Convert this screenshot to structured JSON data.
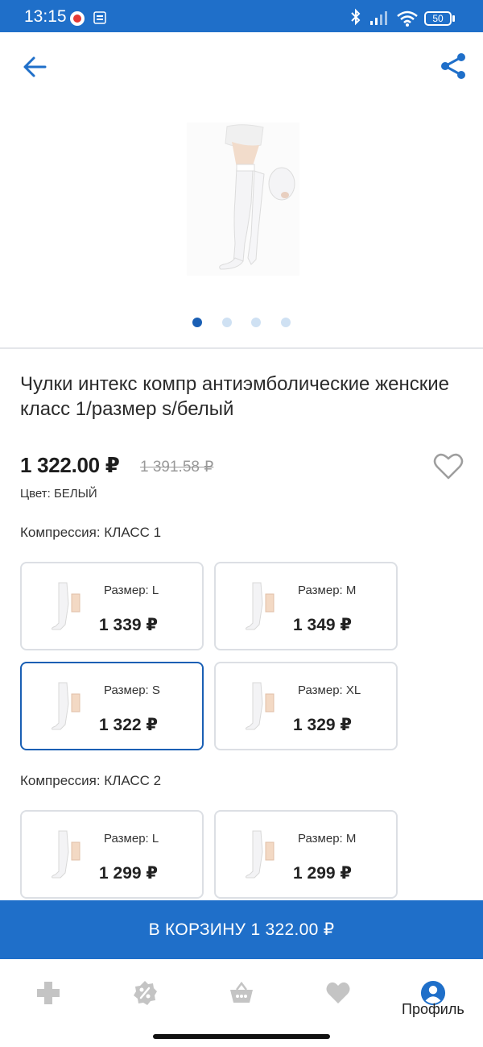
{
  "status_bar": {
    "time": "13:15",
    "battery": "50"
  },
  "header": {
    "back_icon": "arrow-left-icon",
    "share_icon": "share-icon"
  },
  "gallery": {
    "pages": 4,
    "active_page": 1
  },
  "product": {
    "title": "Чулки интекс компр антиэмболические женские класс 1/размер s/белый",
    "price": "1 322.00 ₽",
    "old_price": "1 391.58 ₽",
    "color_line": "Цвет: БЕЛЫЙ",
    "favorite_icon": "heart-outline-icon"
  },
  "variants": {
    "groups": [
      {
        "label": "Компрессия: КЛАСС 1",
        "items": [
          {
            "size": "Размер: L",
            "price": "1 339 ₽",
            "selected": false
          },
          {
            "size": "Размер: M",
            "price": "1 349 ₽",
            "selected": false
          },
          {
            "size": "Размер: S",
            "price": "1 322 ₽",
            "selected": true
          },
          {
            "size": "Размер: XL",
            "price": "1 329 ₽",
            "selected": false
          }
        ]
      },
      {
        "label": "Компрессия: КЛАСС 2",
        "items": [
          {
            "size": "Размер: L",
            "price": "1 299 ₽",
            "selected": false
          },
          {
            "size": "Размер: M",
            "price": "1 299 ₽",
            "selected": false
          }
        ]
      }
    ]
  },
  "cart_button": {
    "label": "В КОРЗИНУ 1 322.00 ₽"
  },
  "tabbar": {
    "tabs": [
      {
        "icon": "pharmacy-cross-icon"
      },
      {
        "icon": "discount-badge-icon"
      },
      {
        "icon": "basket-icon"
      },
      {
        "icon": "heart-icon"
      },
      {
        "icon": "profile-icon",
        "label": "Профиль"
      }
    ]
  },
  "colors": {
    "brand_blue": "#1f6fc9",
    "selected_border": "#1a5fb4",
    "inactive_icon": "#c4c4c4"
  }
}
